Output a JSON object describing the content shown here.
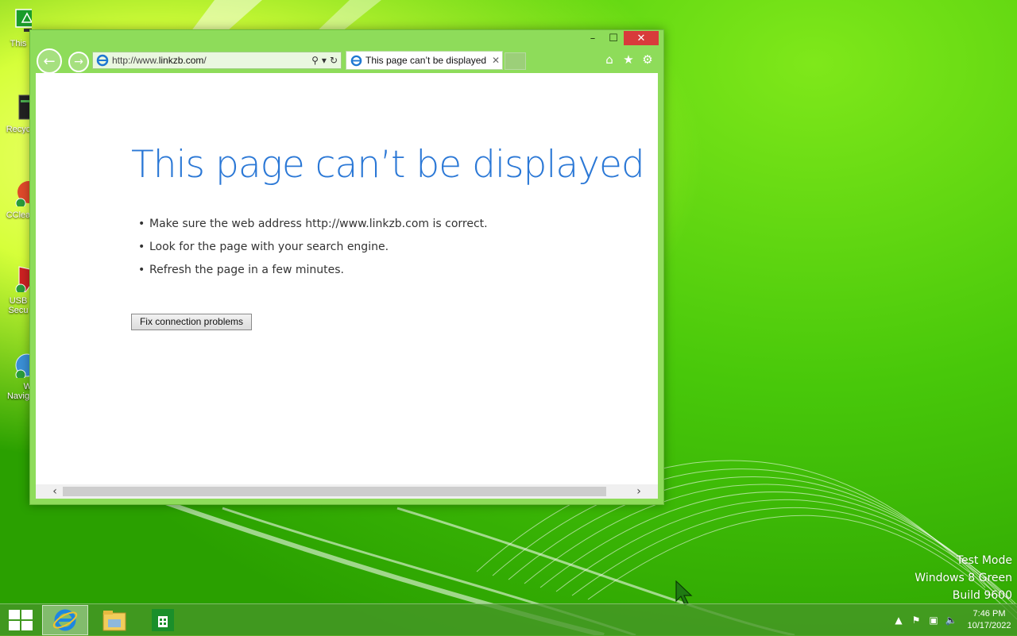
{
  "desktop": {
    "icons": [
      {
        "label": "This",
        "icon": "computer-icon"
      },
      {
        "label": "Recyc",
        "icon": "recycle-bin-icon"
      },
      {
        "label": "CClea",
        "icon": "ccleaner-icon"
      },
      {
        "label": "USB",
        "label2": "Secu",
        "icon": "shield-icon"
      },
      {
        "label": "W",
        "label2": "Navig",
        "icon": "globe-icon"
      }
    ],
    "watermark": {
      "line1": "Test Mode",
      "line2": "Windows 8 Green",
      "line3": "Build 9600"
    }
  },
  "browser": {
    "address": {
      "prefix": "http://www.",
      "domain": "linkzb.com",
      "suffix": "/"
    },
    "tab": {
      "title": "This page can’t be displayed",
      "close": "✕"
    },
    "window_controls": {
      "minimize": "–",
      "maximize": "☐",
      "close": "✕"
    },
    "page": {
      "title": "This page can’t be displayed",
      "bullets": [
        "Make sure the web address http://www.linkzb.com is correct.",
        "Look for the page with your search engine.",
        "Refresh the page in a few minutes."
      ],
      "fix_button": "Fix connection problems"
    }
  },
  "taskbar": {
    "apps": [
      {
        "name": "Internet Explorer",
        "icon": "ie-icon",
        "active": true
      },
      {
        "name": "File Explorer",
        "icon": "folder-icon",
        "active": false
      },
      {
        "name": "Store",
        "icon": "store-icon",
        "active": false
      }
    ],
    "clock": {
      "time": "7:46 PM",
      "date": "10/17/2022"
    }
  }
}
